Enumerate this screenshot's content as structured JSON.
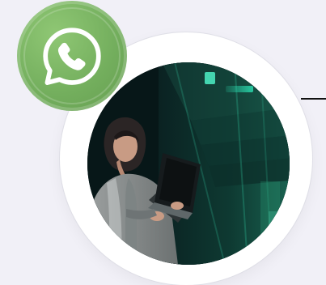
{
  "colors": {
    "page_background": "#f1f0f7",
    "outer_circle": "#ffffff",
    "badge_green": "#73ae5d",
    "icon_white": "#ffffff",
    "photo_teal": "#0b2c28",
    "light_teal": "#2ce7b8",
    "connector_line": "#111111"
  },
  "icons": {
    "badge": "whatsapp-icon"
  }
}
